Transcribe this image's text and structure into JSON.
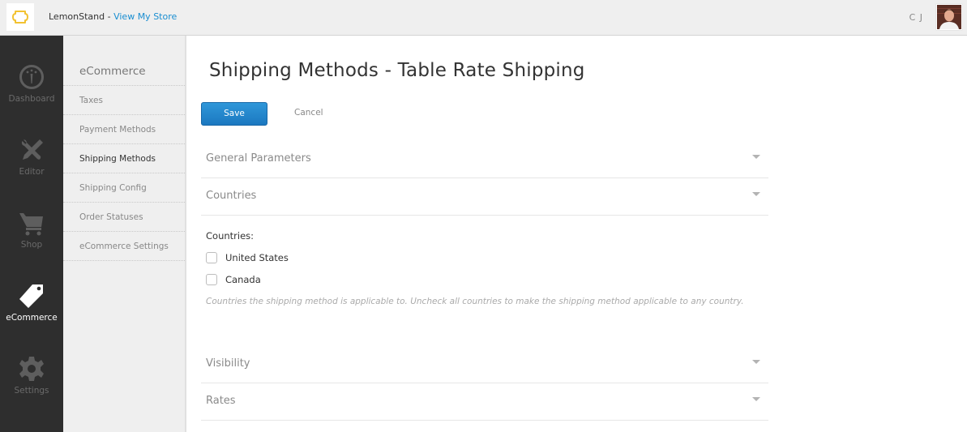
{
  "header": {
    "logo_icon": "lemonstand-logo-icon",
    "brand": "LemonStand",
    "separator": " - ",
    "store_link": "View My Store",
    "user_initials": "C J",
    "avatar_icon": "user-avatar"
  },
  "iconnav": {
    "items": [
      {
        "label": "Dashboard",
        "icon": "dashboard-gauge-icon",
        "active": false
      },
      {
        "label": "Editor",
        "icon": "editor-tools-icon",
        "active": false
      },
      {
        "label": "Shop",
        "icon": "shopping-cart-icon",
        "active": false
      },
      {
        "label": "eCommerce",
        "icon": "price-tag-icon",
        "active": true
      },
      {
        "label": "Settings",
        "icon": "gear-icon",
        "active": false
      }
    ]
  },
  "subnav": {
    "title": "eCommerce",
    "items": [
      {
        "label": "Taxes",
        "active": false
      },
      {
        "label": "Payment Methods",
        "active": false
      },
      {
        "label": "Shipping Methods",
        "active": true
      },
      {
        "label": "Shipping Config",
        "active": false
      },
      {
        "label": "Order Statuses",
        "active": false
      },
      {
        "label": "eCommerce Settings",
        "active": false
      }
    ]
  },
  "main": {
    "title": "Shipping Methods - Table Rate Shipping",
    "save_label": "Save",
    "cancel_label": "Cancel",
    "sections": [
      {
        "title": "General Parameters",
        "icon": "caret-down-icon"
      },
      {
        "title": "Countries",
        "icon": "caret-down-icon"
      },
      {
        "title": "Visibility",
        "icon": "caret-down-icon"
      },
      {
        "title": "Rates",
        "icon": "caret-down-icon"
      }
    ],
    "countries": {
      "label": "Countries:",
      "options": [
        {
          "label": "United States",
          "checked": false
        },
        {
          "label": "Canada",
          "checked": false
        }
      ],
      "help": "Countries the shipping method is applicable to. Uncheck all countries to make the shipping method applicable to any country."
    }
  },
  "colors": {
    "accent": "#1a8ed1",
    "save_button": "#2288cc",
    "nav_bg": "#2e2e2e",
    "subnav_bg": "#efefef",
    "logo_yellow": "#f2c231"
  }
}
